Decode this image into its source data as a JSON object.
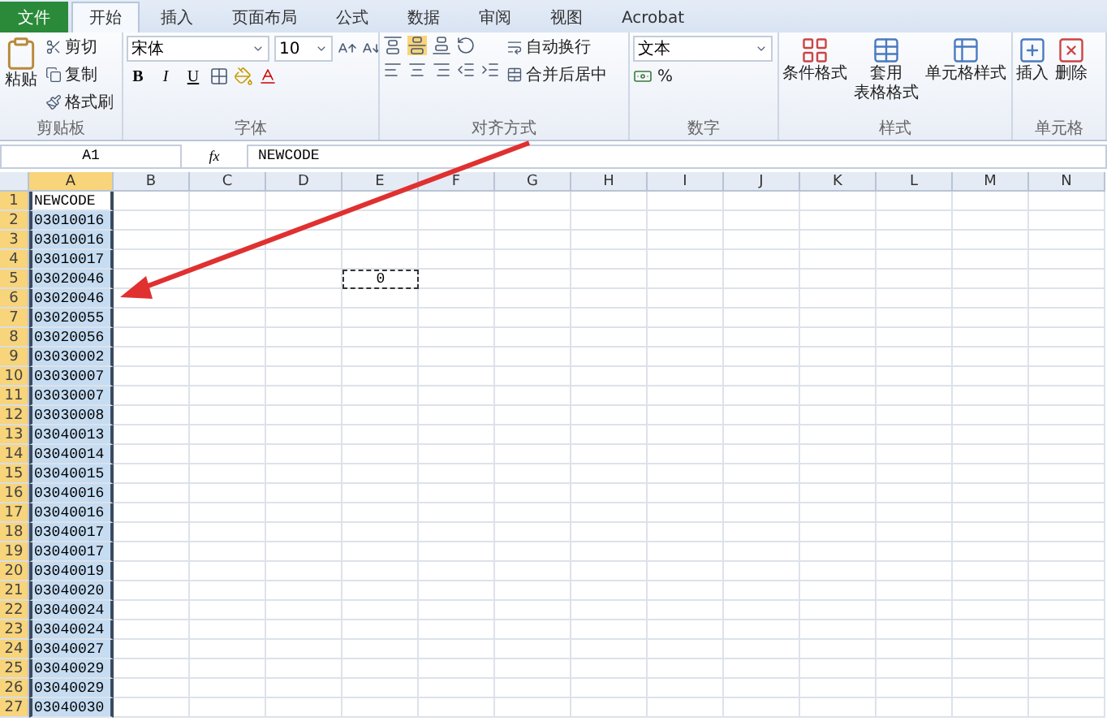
{
  "tabs": [
    {
      "label": "文件",
      "kind": "file",
      "selected": false
    },
    {
      "label": "开始",
      "kind": "tab",
      "selected": true
    },
    {
      "label": "插入",
      "kind": "tab",
      "selected": false
    },
    {
      "label": "页面布局",
      "kind": "tab",
      "selected": false
    },
    {
      "label": "公式",
      "kind": "tab",
      "selected": false
    },
    {
      "label": "数据",
      "kind": "tab",
      "selected": false
    },
    {
      "label": "审阅",
      "kind": "tab",
      "selected": false
    },
    {
      "label": "视图",
      "kind": "tab",
      "selected": false
    },
    {
      "label": "Acrobat",
      "kind": "tab",
      "selected": false
    }
  ],
  "ribbon": [
    {
      "kind": "clipboard",
      "label": "剪贴板",
      "paste": "粘贴",
      "items": [
        "剪切",
        "复制",
        "格式刷"
      ]
    },
    {
      "kind": "font",
      "label": "字体",
      "font_name": "宋体",
      "font_size": "10",
      "styles": [
        "B",
        "I",
        "U"
      ]
    },
    {
      "kind": "alignment",
      "label": "对齐方式",
      "items": [
        "自动换行",
        "合并后居中"
      ]
    },
    {
      "kind": "number",
      "label": "数字",
      "format": "文本",
      "percent": "%"
    },
    {
      "kind": "styles",
      "label": "样式",
      "items": [
        [
          "条件格式"
        ],
        [
          "套用",
          "表格格式"
        ],
        [
          "单元格样式"
        ]
      ]
    },
    {
      "kind": "cells",
      "label": "单元格",
      "items": [
        "插入",
        "删除"
      ]
    }
  ],
  "formula_bar": {
    "name_box": "A1",
    "function_label": "fx",
    "formula": "NEWCODE"
  },
  "columns": [
    {
      "label": "A",
      "selected": true
    },
    {
      "label": "B",
      "selected": false
    },
    {
      "label": "C",
      "selected": false
    },
    {
      "label": "D",
      "selected": false
    },
    {
      "label": "E",
      "selected": false
    },
    {
      "label": "F",
      "selected": false
    },
    {
      "label": "G",
      "selected": false
    },
    {
      "label": "H",
      "selected": false
    },
    {
      "label": "I",
      "selected": false
    },
    {
      "label": "J",
      "selected": false
    },
    {
      "label": "K",
      "selected": false
    },
    {
      "label": "L",
      "selected": false
    },
    {
      "label": "M",
      "selected": false
    },
    {
      "label": "N",
      "selected": false
    }
  ],
  "rows": [
    {
      "number": "1",
      "cells": [
        {
          "text": "NEWCODE",
          "selected": true,
          "active": true
        }
      ]
    },
    {
      "number": "2",
      "cells": [
        {
          "text": "03010016",
          "selected": true,
          "active": false
        }
      ]
    },
    {
      "number": "3",
      "cells": [
        {
          "text": "03010016",
          "selected": true,
          "active": false
        }
      ]
    },
    {
      "number": "4",
      "cells": [
        {
          "text": "03010017",
          "selected": true,
          "active": false
        }
      ]
    },
    {
      "number": "5",
      "cells": [
        {
          "text": "03020046",
          "selected": true,
          "active": false
        },
        {},
        {},
        {},
        {
          "text": "0",
          "selected": false,
          "active": false,
          "copied": true
        }
      ]
    },
    {
      "number": "6",
      "cells": [
        {
          "text": "03020046",
          "selected": true,
          "active": false
        }
      ]
    },
    {
      "number": "7",
      "cells": [
        {
          "text": "03020055",
          "selected": true,
          "active": false
        }
      ]
    },
    {
      "number": "8",
      "cells": [
        {
          "text": "03020056",
          "selected": true,
          "active": false
        }
      ]
    },
    {
      "number": "9",
      "cells": [
        {
          "text": "03030002",
          "selected": true,
          "active": false
        }
      ]
    },
    {
      "number": "10",
      "cells": [
        {
          "text": "03030007",
          "selected": true,
          "active": false
        }
      ]
    },
    {
      "number": "11",
      "cells": [
        {
          "text": "03030007",
          "selected": true,
          "active": false
        }
      ]
    },
    {
      "number": "12",
      "cells": [
        {
          "text": "03030008",
          "selected": true,
          "active": false
        }
      ]
    },
    {
      "number": "13",
      "cells": [
        {
          "text": "03040013",
          "selected": true,
          "active": false
        }
      ]
    },
    {
      "number": "14",
      "cells": [
        {
          "text": "03040014",
          "selected": true,
          "active": false
        }
      ]
    },
    {
      "number": "15",
      "cells": [
        {
          "text": "03040015",
          "selected": true,
          "active": false
        }
      ]
    },
    {
      "number": "16",
      "cells": [
        {
          "text": "03040016",
          "selected": true,
          "active": false
        }
      ]
    },
    {
      "number": "17",
      "cells": [
        {
          "text": "03040016",
          "selected": true,
          "active": false
        }
      ]
    },
    {
      "number": "18",
      "cells": [
        {
          "text": "03040017",
          "selected": true,
          "active": false
        }
      ]
    },
    {
      "number": "19",
      "cells": [
        {
          "text": "03040017",
          "selected": true,
          "active": false
        }
      ]
    },
    {
      "number": "20",
      "cells": [
        {
          "text": "03040019",
          "selected": true,
          "active": false
        }
      ]
    },
    {
      "number": "21",
      "cells": [
        {
          "text": "03040020",
          "selected": true,
          "active": false
        }
      ]
    },
    {
      "number": "22",
      "cells": [
        {
          "text": "03040024",
          "selected": true,
          "active": false
        }
      ]
    },
    {
      "number": "23",
      "cells": [
        {
          "text": "03040024",
          "selected": true,
          "active": false
        }
      ]
    },
    {
      "number": "24",
      "cells": [
        {
          "text": "03040027",
          "selected": true,
          "active": false
        }
      ]
    },
    {
      "number": "25",
      "cells": [
        {
          "text": "03040029",
          "selected": true,
          "active": false
        }
      ]
    },
    {
      "number": "26",
      "cells": [
        {
          "text": "03040029",
          "selected": true,
          "active": false
        }
      ]
    },
    {
      "number": "27",
      "cells": [
        {
          "text": "03040030",
          "selected": true,
          "active": false
        }
      ]
    }
  ]
}
